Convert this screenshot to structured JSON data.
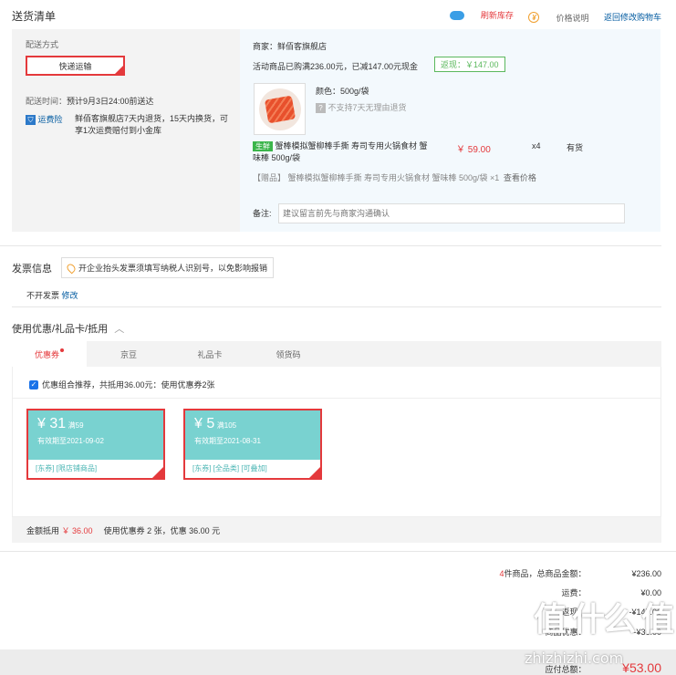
{
  "header": {
    "title": "送货清单",
    "refresh_label": "刷新库存",
    "price_label": "价格说明",
    "back_label": "返回修改购物车"
  },
  "shipping": {
    "method_title": "配送方式",
    "method_button": "快递运输",
    "time_label": "配送时间：",
    "time_value": "预计9月3日24:00前送达",
    "insurance_label": "运费险",
    "insurance_text": "鲜佰客旗舰店7天内退货，15天内换货，可享1次运费赔付到小金库"
  },
  "store": {
    "merchant": "商家：鲜佰客旗舰店",
    "promo_text": "活动商品已购满236.00元，已减147.00元现金",
    "promo_badge": "返现：￥147.00"
  },
  "product": {
    "spec": "颜色：500g/袋",
    "return_policy": "不支持7天无理由退货",
    "fresh_tag": "生鲜",
    "name": "蟹棒模拟蟹柳棒手撕 寿司专用火锅食材 蟹味棒 500g/袋",
    "price": "￥ 59.00",
    "qty": "x4",
    "stock": "有货",
    "gift": "【赠品】 蟹棒模拟蟹柳棒手撕 寿司专用火锅食材 蟹味棒 500g/袋 ×1",
    "gift_price_link": "查看价格",
    "memo_label": "备注:",
    "memo_placeholder": "建议留言前先与商家沟通确认"
  },
  "invoice": {
    "title": "发票信息",
    "tip": "开企业抬头发票须填写纳税人识别号，以免影响报销",
    "value": "不开发票",
    "edit": "修改"
  },
  "discount": {
    "title": "使用优惠/礼品卡/抵用",
    "tabs": [
      "优惠券",
      "京豆",
      "礼品卡",
      "领货码"
    ],
    "recommend": "优惠组合推荐，共抵用36.00元：使用优惠券2张",
    "coupons": [
      {
        "amount": "¥ 31",
        "cond": "满59",
        "expiry": "有效期至2021-09-02",
        "tags": "[东券] [限店铺商品]"
      },
      {
        "amount": "¥ 5",
        "cond": "满105",
        "expiry": "有效期至2021-08-31",
        "tags": "[东券] [全品类] [可叠加]"
      }
    ],
    "total_label": "金额抵用",
    "total_value": "￥ 36.00",
    "summary": "使用优惠券 2 张，优惠 36.00 元"
  },
  "totals": {
    "count": "4",
    "count_label": "件商品，总商品金额：",
    "goods_amount": "¥236.00",
    "freight_label": "运费：",
    "freight_value": "¥0.00",
    "reduce_label": "返现：",
    "reduce_value": "-¥147.00",
    "coupon_label": "商品优惠：",
    "coupon_value": "-¥36.00",
    "payable_label": "应付总额：",
    "payable_value": "¥53.00"
  },
  "watermark": {
    "brand": "值 什么 值",
    "url": "zhizhizhi.com"
  }
}
